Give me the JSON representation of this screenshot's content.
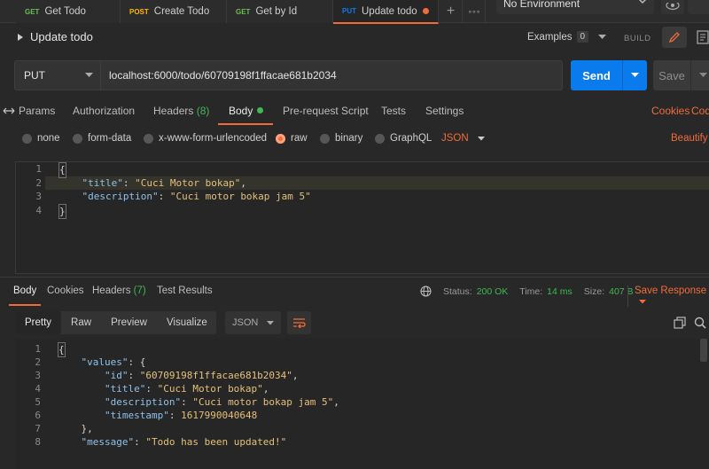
{
  "tabs": [
    {
      "method": "GET",
      "label": "Get Todo"
    },
    {
      "method": "POST",
      "label": "Create Todo"
    },
    {
      "method": "GET",
      "label": "Get by Id"
    },
    {
      "method": "PUT",
      "label": "Update todo"
    }
  ],
  "tab_tools": {
    "add": "+",
    "more": "∘∘∘"
  },
  "environment": {
    "selected": "No Environment"
  },
  "request": {
    "title": "Update todo",
    "examples_label": "Examples",
    "examples_count": "0",
    "build_label": "BUILD",
    "method": "PUT",
    "url": "localhost:6000/todo/60709198f1ffacae681b2034",
    "send_label": "Send",
    "save_label": "Save"
  },
  "request_tabs": {
    "params": "Params",
    "authorization": "Authorization",
    "headers": "Headers",
    "headers_count": "(8)",
    "body": "Body",
    "prerequest": "Pre-request Script",
    "tests": "Tests",
    "settings": "Settings",
    "cookies": "Cookies",
    "code": "Code"
  },
  "body_types": {
    "none": "none",
    "form_data": "form-data",
    "urlencoded": "x-www-form-urlencoded",
    "raw": "raw",
    "binary": "binary",
    "graphql": "GraphQL",
    "language": "JSON",
    "beautify": "Beautify"
  },
  "request_body": {
    "line_numbers": [
      "1",
      "2",
      "3",
      "4"
    ],
    "open_brace": "{",
    "title_key": "\"title\"",
    "title_value": "\"Cuci Motor bokap\"",
    "description_key": "\"description\"",
    "description_value": "\"Cuci motor bokap jam 5\"",
    "close_brace": "}"
  },
  "response_tabs": {
    "body": "Body",
    "cookies": "Cookies",
    "headers": "Headers",
    "headers_count": "(7)",
    "test_results": "Test Results"
  },
  "response_status": {
    "status_label": "Status:",
    "status_value": "200 OK",
    "time_label": "Time:",
    "time_value": "14 ms",
    "size_label": "Size:",
    "size_value": "407 B",
    "save_response": "Save Response"
  },
  "response_view": {
    "pretty": "Pretty",
    "raw": "Raw",
    "preview": "Preview",
    "visualize": "Visualize",
    "language": "JSON"
  },
  "response_body": {
    "line_numbers": [
      "1",
      "2",
      "3",
      "4",
      "5",
      "6",
      "7",
      "8"
    ],
    "open_brace": "{",
    "values_key": "\"values\"",
    "id_key": "\"id\"",
    "id_value": "\"60709198f1ffacae681b2034\"",
    "title_key": "\"title\"",
    "title_value": "\"Cuci Motor bokap\"",
    "description_key": "\"description\"",
    "description_value": "\"Cuci motor bokap jam 5\"",
    "timestamp_key": "\"timestamp\"",
    "timestamp_value": "1617990040648",
    "close_obj": "},",
    "message_key": "\"message\"",
    "message_value": "\"Todo has been updated!\""
  },
  "colors": {
    "accent": "#f26b3a",
    "send_blue": "#097bed",
    "ok_green": "#3fb950",
    "background": "#282828"
  },
  "icons": [
    "chevron-down-icon",
    "eye-icon",
    "edit-icon",
    "document-icon",
    "globe-icon",
    "copy-icon",
    "search-icon",
    "wrap-lines-icon",
    "caret-right-icon",
    "resize-handle-icon"
  ]
}
